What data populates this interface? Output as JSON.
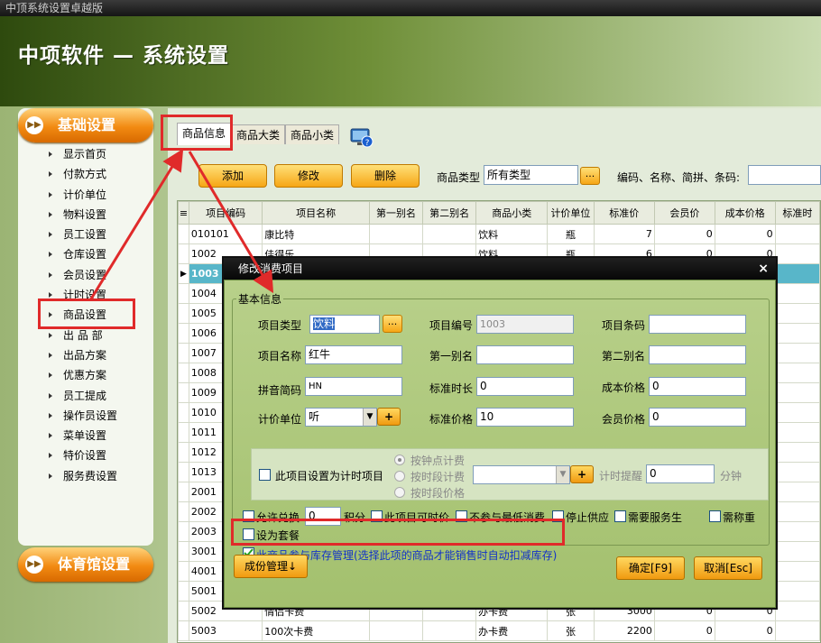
{
  "window": {
    "title": "中顶系统设置卓越版"
  },
  "header": {
    "title": "中项软件 — 系统设置"
  },
  "sidebar": {
    "basic_label": "基础设置",
    "gym_label": "体育馆设置",
    "items": [
      "显示首页",
      "付款方式",
      "计价单位",
      "物料设置",
      "员工设置",
      "仓库设置",
      "会员设置",
      "计时设置",
      "商品设置",
      "出 品 部",
      "出品方案",
      "优惠方案",
      "员工提成",
      "操作员设置",
      "菜单设置",
      "特价设置",
      "服务费设置"
    ]
  },
  "tabs": [
    "商品信息",
    "商品大类",
    "商品小类"
  ],
  "toolbar": {
    "add": "添加",
    "edit": "修改",
    "delete": "删除",
    "type_label": "商品类型",
    "type_value": "所有类型",
    "dots": "...",
    "search_label": "编码、名称、简拼、条码:"
  },
  "grid": {
    "columns": [
      "项目编码",
      "项目名称",
      "第一别名",
      "第二别名",
      "商品小类",
      "计价单位",
      "标准价",
      "会员价",
      "成本价格",
      "标准时"
    ],
    "rows": [
      {
        "code": "010101",
        "name": "康比特",
        "alias1": "",
        "alias2": "",
        "sub": "饮料",
        "unit": "瓶",
        "std": "7",
        "member": "0",
        "cost": "0"
      },
      {
        "code": "1002",
        "name": "佳得乐",
        "alias1": "",
        "alias2": "",
        "sub": "饮料",
        "unit": "瓶",
        "std": "6",
        "member": "0",
        "cost": "0"
      },
      {
        "code": "1003",
        "name": "",
        "alias1": "",
        "alias2": "",
        "sub": "",
        "unit": "",
        "std": "",
        "member": "",
        "cost": ""
      },
      {
        "code": "1004",
        "name": "",
        "alias1": "",
        "alias2": "",
        "sub": "",
        "unit": "",
        "std": "",
        "member": "",
        "cost": ""
      },
      {
        "code": "1005",
        "name": "",
        "alias1": "",
        "alias2": "",
        "sub": "",
        "unit": "",
        "std": "",
        "member": "",
        "cost": ""
      },
      {
        "code": "1006",
        "name": "",
        "alias1": "",
        "alias2": "",
        "sub": "",
        "unit": "",
        "std": "",
        "member": "",
        "cost": ""
      },
      {
        "code": "1007",
        "name": "",
        "alias1": "",
        "alias2": "",
        "sub": "",
        "unit": "",
        "std": "",
        "member": "",
        "cost": ""
      },
      {
        "code": "1008",
        "name": "",
        "alias1": "",
        "alias2": "",
        "sub": "",
        "unit": "",
        "std": "",
        "member": "",
        "cost": ""
      },
      {
        "code": "1009",
        "name": "",
        "alias1": "",
        "alias2": "",
        "sub": "",
        "unit": "",
        "std": "",
        "member": "",
        "cost": ""
      },
      {
        "code": "1010",
        "name": "",
        "alias1": "",
        "alias2": "",
        "sub": "",
        "unit": "",
        "std": "",
        "member": "",
        "cost": ""
      },
      {
        "code": "1011",
        "name": "",
        "alias1": "",
        "alias2": "",
        "sub": "",
        "unit": "",
        "std": "",
        "member": "",
        "cost": ""
      },
      {
        "code": "1012",
        "name": "",
        "alias1": "",
        "alias2": "",
        "sub": "",
        "unit": "",
        "std": "",
        "member": "",
        "cost": ""
      },
      {
        "code": "1013",
        "name": "",
        "alias1": "",
        "alias2": "",
        "sub": "",
        "unit": "",
        "std": "",
        "member": "",
        "cost": ""
      },
      {
        "code": "2001",
        "name": "",
        "alias1": "",
        "alias2": "",
        "sub": "",
        "unit": "",
        "std": "",
        "member": "",
        "cost": ""
      },
      {
        "code": "2002",
        "name": "",
        "alias1": "",
        "alias2": "",
        "sub": "",
        "unit": "",
        "std": "",
        "member": "",
        "cost": ""
      },
      {
        "code": "2003",
        "name": "",
        "alias1": "",
        "alias2": "",
        "sub": "",
        "unit": "",
        "std": "",
        "member": "",
        "cost": ""
      },
      {
        "code": "3001",
        "name": "",
        "alias1": "",
        "alias2": "",
        "sub": "",
        "unit": "",
        "std": "",
        "member": "",
        "cost": ""
      },
      {
        "code": "4001",
        "name": "",
        "alias1": "",
        "alias2": "",
        "sub": "",
        "unit": "",
        "std": "",
        "member": "",
        "cost": ""
      },
      {
        "code": "5001",
        "name": "",
        "alias1": "",
        "alias2": "",
        "sub": "",
        "unit": "",
        "std": "",
        "member": "",
        "cost": ""
      },
      {
        "code": "5002",
        "name": "情侣卡费",
        "alias1": "",
        "alias2": "",
        "sub": "办卡费",
        "unit": "张",
        "std": "3000",
        "member": "0",
        "cost": "0"
      },
      {
        "code": "5003",
        "name": "100次卡费",
        "alias1": "",
        "alias2": "",
        "sub": "办卡费",
        "unit": "张",
        "std": "2200",
        "member": "0",
        "cost": "0"
      }
    ]
  },
  "dialog": {
    "title": "修改消费项目",
    "close": "×",
    "group": "基本信息",
    "type_label": "项目类型",
    "type_value": "饮料",
    "code_label": "项目编号",
    "code_value": "1003",
    "barcode_label": "项目条码",
    "barcode_value": "",
    "name_label": "项目名称",
    "name_value": "红牛",
    "alias1_label": "第一别名",
    "alias1_value": "",
    "alias2_label": "第二别名",
    "alias2_value": "",
    "pinyin_label": "拼音简码",
    "pinyin_value": "HN",
    "duration_label": "标准时长",
    "duration_value": "0",
    "cost_label": "成本价格",
    "cost_value": "0",
    "unit_label": "计价单位",
    "unit_value": "听",
    "price_label": "标准价格",
    "price_value": "10",
    "member_label": "会员价格",
    "member_value": "0",
    "timer_label": "此项目设置为计时项目",
    "radio1": "按钟点计费",
    "radio2": "按时段计费",
    "radio3": "按时段价格",
    "remind_label": "计时提醒",
    "remind_value": "0",
    "minutes": "分钟",
    "exchange_label": "允许兑换",
    "exchange_value": "0",
    "points": "积分",
    "timeprice": "此项目可时价",
    "nomin": "不参与最低消费",
    "stop": "停止供应",
    "service": "需要服务生",
    "weigh": "需称重",
    "package": "设为套餐",
    "inventory": "此商品参与库存管理(选择此项的商品才能销售时自动扣减库存)",
    "ingredients": "成份管理↓",
    "ok": "确定[F9]",
    "cancel": "取消[Esc]"
  },
  "colors": {
    "accent": "#f28a12",
    "highlight": "#e02a2a",
    "selected_row": "#58b6c9"
  }
}
